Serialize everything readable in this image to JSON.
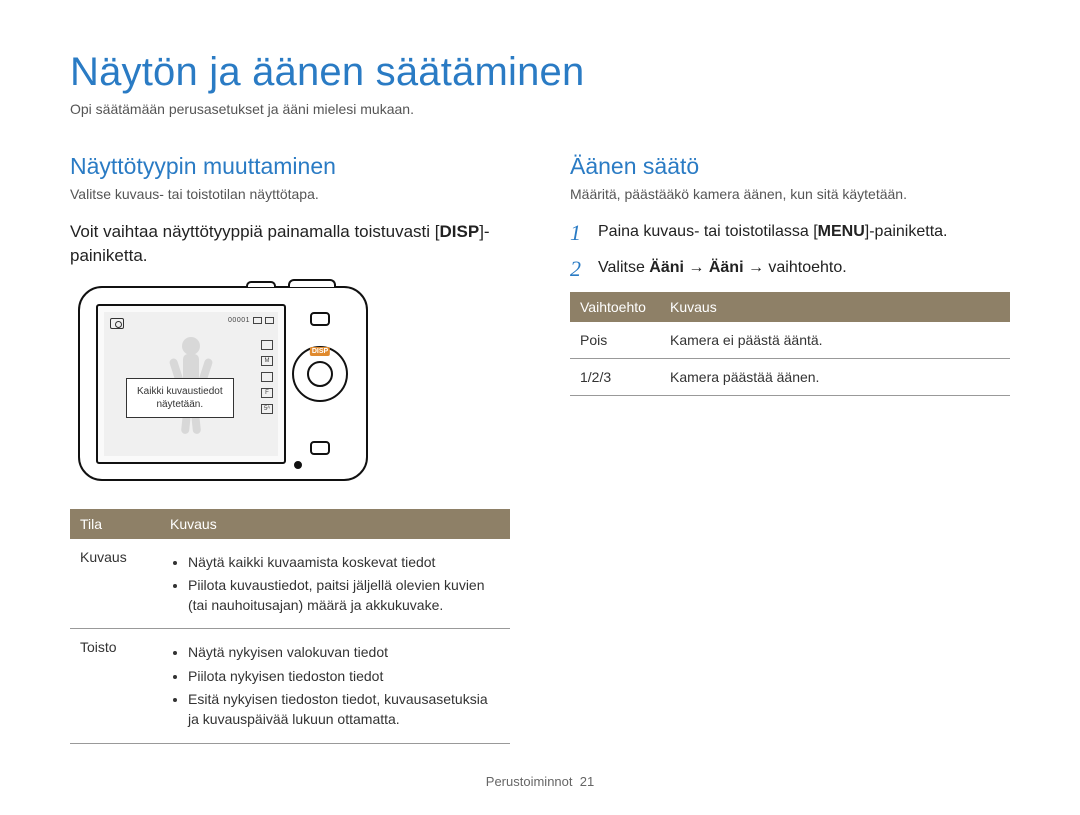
{
  "title": "Näytön ja äänen säätäminen",
  "subtitle": "Opi säätämään perusasetukset ja ääni mielesi mukaan.",
  "left": {
    "heading": "Näyttötyypin muuttaminen",
    "caption": "Valitse kuvaus- tai toistotilan näyttötapa.",
    "body_pre": "Voit vaihtaa näyttötyyppiä painamalla toistuvasti [",
    "body_key": "DISP",
    "body_post": "]-painiketta.",
    "camera": {
      "counter": "00001",
      "callout_l1": "Kaikki kuvaustiedot",
      "callout_l2": "näytetään.",
      "disp_label": "DISP",
      "right_mini": [
        "",
        "M",
        "",
        "F",
        "5ᴬ"
      ]
    },
    "table": {
      "headers": [
        "Tila",
        "Kuvaus"
      ],
      "rows": [
        {
          "mode": "Kuvaus",
          "items": [
            "Näytä kaikki kuvaamista koskevat tiedot",
            "Piilota kuvaustiedot, paitsi jäljellä olevien kuvien (tai nauhoitusajan) määrä ja akkukuvake."
          ]
        },
        {
          "mode": "Toisto",
          "items": [
            "Näytä nykyisen valokuvan tiedot",
            "Piilota nykyisen tiedoston tiedot",
            "Esitä nykyisen tiedoston tiedot, kuvausasetuksia ja kuvauspäivää lukuun ottamatta."
          ]
        }
      ]
    }
  },
  "right": {
    "heading": "Äänen säätö",
    "caption": "Määritä, päästääkö kamera äänen, kun sitä käytetään.",
    "steps": [
      {
        "pre": "Paina kuvaus- tai toistotilassa [",
        "key": "MENU",
        "post": "]-painiketta."
      },
      {
        "pre": "Valitse ",
        "bold1": "Ääni",
        "arrow1": " → ",
        "bold2": "Ääni",
        "arrow2": " → ",
        "tail": "vaihtoehto."
      }
    ],
    "table": {
      "headers": [
        "Vaihtoehto",
        "Kuvaus"
      ],
      "rows": [
        {
          "opt": "Pois",
          "desc": "Kamera ei päästä ääntä."
        },
        {
          "opt": "1/2/3",
          "desc": "Kamera päästää äänen."
        }
      ]
    }
  },
  "footer": {
    "section": "Perustoiminnot",
    "page": "21"
  }
}
